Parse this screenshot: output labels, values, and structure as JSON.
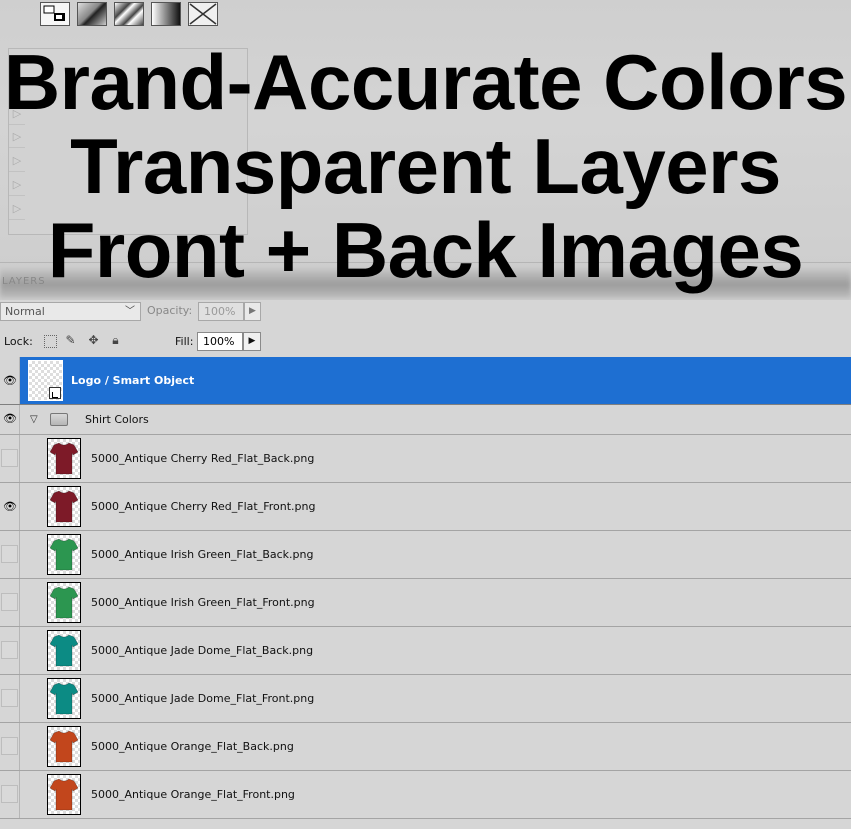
{
  "toolbar": {
    "icons": [
      "layer-comp-icon",
      "gradient-icon",
      "pattern-icon",
      "gradient-fill-icon",
      "none-icon"
    ]
  },
  "banner": {
    "line1": "Brand-Accurate Colors",
    "line2": "Transparent Layers",
    "line3": "Front + Back Images"
  },
  "panel": {
    "tab_label": "LAYERS",
    "blend_mode": "Normal",
    "opacity_label": "Opacity:",
    "opacity_value": "100%",
    "lock_label": "Lock:",
    "fill_label": "Fill:",
    "fill_value": "100%"
  },
  "layers": {
    "logo": {
      "name": "Logo / Smart Object",
      "visible": true,
      "selected": true
    },
    "group": {
      "name": "Shirt Colors",
      "visible": true,
      "expanded": true
    },
    "items": [
      {
        "name": "5000_Antique Cherry Red_Flat_Back.png",
        "visible": false,
        "color": "#7d1a28"
      },
      {
        "name": "5000_Antique Cherry Red_Flat_Front.png",
        "visible": true,
        "color": "#7d1a28"
      },
      {
        "name": "5000_Antique Irish Green_Flat_Back.png",
        "visible": false,
        "color": "#2c9650"
      },
      {
        "name": "5000_Antique Irish Green_Flat_Front.png",
        "visible": false,
        "color": "#2c9650"
      },
      {
        "name": "5000_Antique Jade Dome_Flat_Back.png",
        "visible": false,
        "color": "#0c8b84"
      },
      {
        "name": "5000_Antique Jade Dome_Flat_Front.png",
        "visible": false,
        "color": "#0c8b84"
      },
      {
        "name": "5000_Antique Orange_Flat_Back.png",
        "visible": false,
        "color": "#c2461c"
      },
      {
        "name": "5000_Antique Orange_Flat_Front.png",
        "visible": false,
        "color": "#c2461c"
      }
    ]
  },
  "colors": {
    "selection": "#1e6fd2",
    "panel_bg": "#d6d6d6"
  }
}
